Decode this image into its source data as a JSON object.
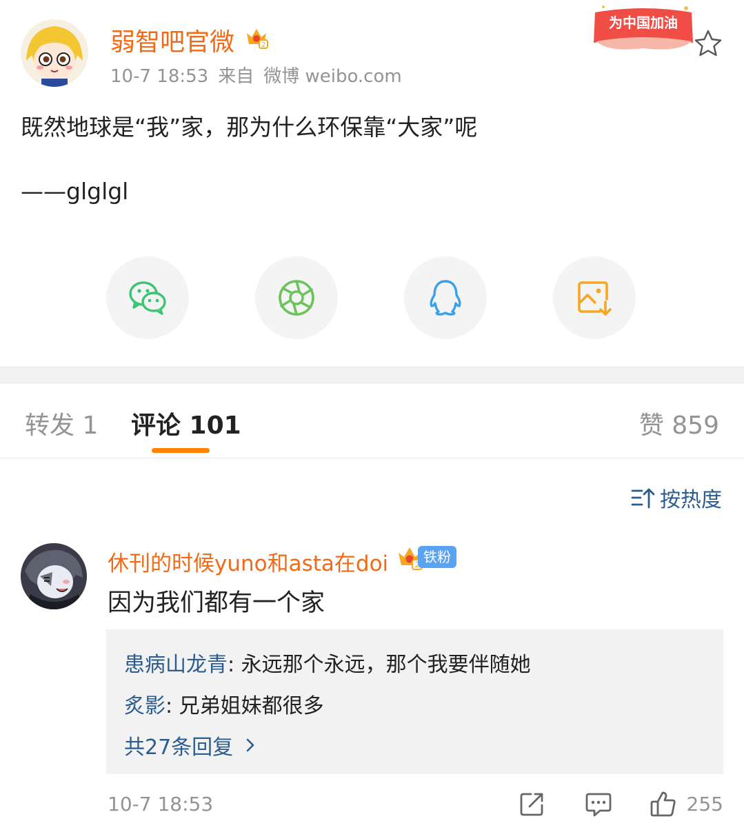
{
  "post": {
    "author": "弱智吧官微",
    "time": "10-7 18:53",
    "source_prefix": "来自",
    "source": "微博 weibo.com",
    "cheer_badge": "为中国加油",
    "text": "既然地球是“我”家，那为什么环保靠“大家”呢",
    "signature": "——glglgl"
  },
  "share": [
    {
      "name": "wechat-icon",
      "color": "#3cc472"
    },
    {
      "name": "moments-icon",
      "color": "#6ac45a"
    },
    {
      "name": "qq-icon",
      "color": "#3aa0ea"
    },
    {
      "name": "save-image-icon",
      "color": "#f5a623"
    }
  ],
  "tabs": {
    "repost": "转发 1",
    "comment": "评论 101",
    "like": "赞 859"
  },
  "sort_label": "按热度",
  "comment": {
    "user": "休刊的时候yuno和asta在doi",
    "fan_badge": "铁粉",
    "text": "因为我们都有一个家",
    "replies": [
      {
        "name": "患病山龙青",
        "text": ": 永远那个永远，那个我要伴随她"
      },
      {
        "name": "炙影",
        "text": ": 兄弟姐妹都很多"
      }
    ],
    "more_replies": "共27条回复",
    "time": "10-7 18:53",
    "likes": "255"
  },
  "colors": {
    "accent_orange": "#ff8200",
    "name_orange": "#f26a16",
    "link_blue": "#2a5c8f",
    "gray": "#939393"
  }
}
